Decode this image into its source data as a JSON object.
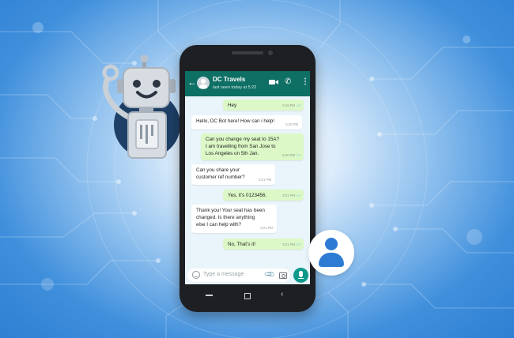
{
  "chat": {
    "contact_name": "DC Travels",
    "status": "last seen today at 5:22",
    "messages": [
      {
        "direction": "out",
        "text": "Hey",
        "time": "5:18 PM"
      },
      {
        "direction": "in",
        "text": "Hello, DC Bot here! How can i help!",
        "time": "5:20 PM"
      },
      {
        "direction": "out",
        "text": "Can you change my seat to 15A?\nI am travelling from San Jose to\nLos Angeles on 5th Jan.",
        "time": "5:20 PM"
      },
      {
        "direction": "in",
        "text": "Can you share your\ncustomer ref number?",
        "time": "5:21 PM"
      },
      {
        "direction": "out",
        "text": "Yes, it's  0123456.",
        "time": "5:21 PM"
      },
      {
        "direction": "in",
        "text": "Thank you! Your seat has been\nchanged. Is there anything\nelse I can help with?",
        "time": "5:21 PM"
      },
      {
        "direction": "out",
        "text": "No, That's it!",
        "time": "5:21 PM"
      }
    ],
    "input": {
      "placeholder": "Type a message"
    },
    "read_receipt_color": "#5cb4e6"
  },
  "icons": {
    "back": "arrow-left-icon",
    "video": "video-call-icon",
    "call": "phone-icon",
    "menu": "more-vertical-icon",
    "emoji": "emoji-icon",
    "attach": "paperclip-icon",
    "camera": "camera-icon",
    "mic": "mic-icon"
  },
  "colors": {
    "header": "#0e6f64",
    "outgoing_bubble": "#dcf8c6",
    "incoming_bubble": "#ffffff",
    "chat_background": "#e9f4fb",
    "mic_button": "#0e9a8a",
    "background_blue": "#2f7fd3"
  }
}
